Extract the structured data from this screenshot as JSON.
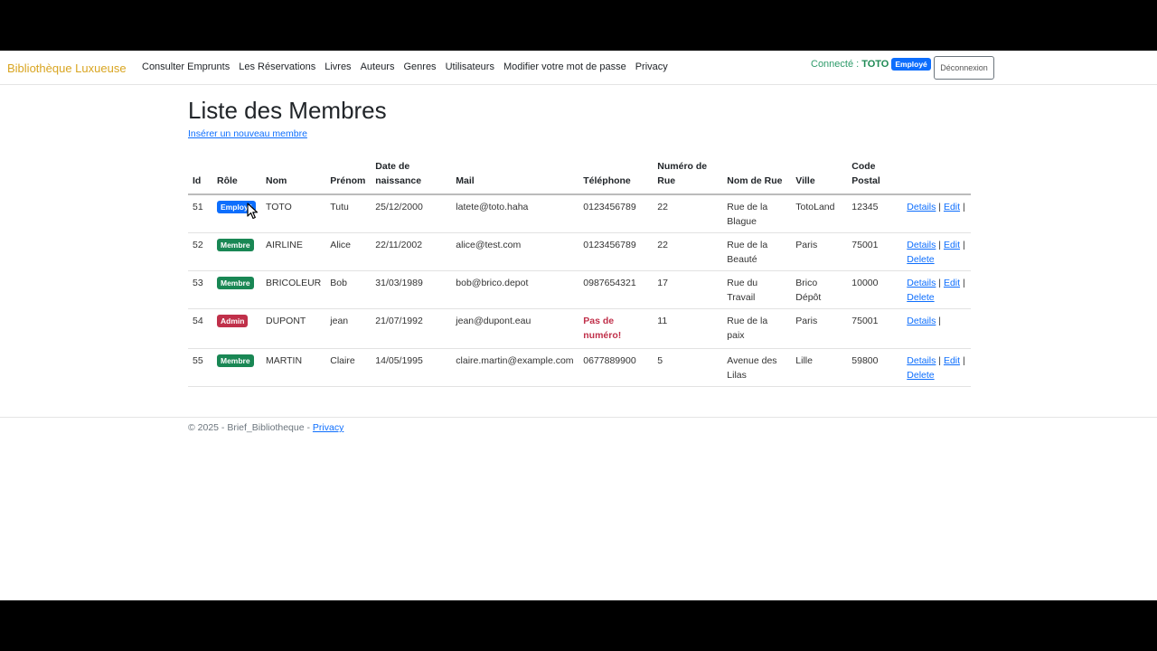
{
  "navbar": {
    "brand": "Bibliothèque Luxueuse",
    "links": [
      "Consulter Emprunts",
      "Les Réservations",
      "Livres",
      "Auteurs",
      "Genres",
      "Utilisateurs",
      "Modifier votre mot de passe",
      "Privacy"
    ],
    "connected_label": "Connecté :",
    "username": "TOTO",
    "user_role": "Employé",
    "logout": "Déconnexion"
  },
  "page": {
    "title": "Liste des Membres",
    "create_link": "Insérer un nouveau membre"
  },
  "table": {
    "headers": [
      "Id",
      "Rôle",
      "Nom",
      "Prénom",
      "Date de naissance",
      "Mail",
      "Téléphone",
      "Numéro de Rue",
      "Nom de Rue",
      "Ville",
      "Code Postal",
      ""
    ],
    "rows": [
      {
        "id": "51",
        "role": "Employé",
        "role_color": "blue",
        "nom": "TOTO",
        "prenom": "Tutu",
        "date": "25/12/2000",
        "mail": "latete@toto.haha",
        "tel": "0123456789",
        "num": "22",
        "rue": "Rue de la Blague",
        "ville": "TotoLand",
        "cp": "12345",
        "actions": [
          "Details",
          "Edit"
        ]
      },
      {
        "id": "52",
        "role": "Membre",
        "role_color": "green",
        "nom": "AIRLINE",
        "prenom": "Alice",
        "date": "22/11/2002",
        "mail": "alice@test.com",
        "tel": "0123456789",
        "num": "22",
        "rue": "Rue de la Beauté",
        "ville": "Paris",
        "cp": "75001",
        "actions": [
          "Details",
          "Edit",
          "Delete"
        ]
      },
      {
        "id": "53",
        "role": "Membre",
        "role_color": "green",
        "nom": "BRICOLEUR",
        "prenom": "Bob",
        "date": "31/03/1989",
        "mail": "bob@brico.depot",
        "tel": "0987654321",
        "num": "17",
        "rue": "Rue du Travail",
        "ville": "Brico Dépôt",
        "cp": "10000",
        "actions": [
          "Details",
          "Edit",
          "Delete"
        ]
      },
      {
        "id": "54",
        "role": "Admin",
        "role_color": "red",
        "nom": "DUPONT",
        "prenom": "jean",
        "date": "21/07/1992",
        "mail": "jean@dupont.eau",
        "tel": "Pas de numéro!",
        "tel_missing": true,
        "num": "11",
        "rue": "Rue de la paix",
        "ville": "Paris",
        "cp": "75001",
        "actions": [
          "Details"
        ]
      },
      {
        "id": "55",
        "role": "Membre",
        "role_color": "green",
        "nom": "MARTIN",
        "prenom": "Claire",
        "date": "14/05/1995",
        "mail": "claire.martin@example.com",
        "tel": "0677889900",
        "num": "5",
        "rue": "Avenue des Lilas",
        "ville": "Lille",
        "cp": "59800",
        "actions": [
          "Details",
          "Edit",
          "Delete"
        ]
      }
    ]
  },
  "footer": {
    "text": "© 2025 - Brief_Bibliotheque -",
    "privacy": "Privacy"
  }
}
